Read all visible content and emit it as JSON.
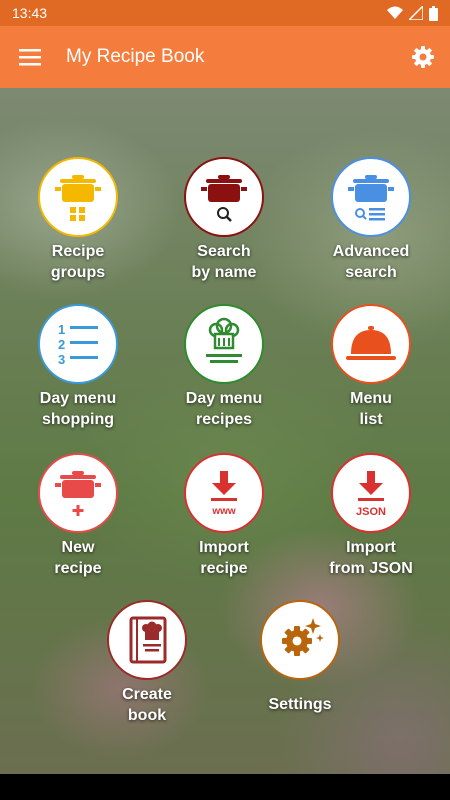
{
  "status_bar": {
    "time": "13:43"
  },
  "app_bar": {
    "title": "My Recipe Book"
  },
  "tiles": [
    {
      "label": "Recipe\ngroups",
      "icon": "pot-groups-icon",
      "color": "#f5b800"
    },
    {
      "label": "Search\nby name",
      "icon": "pot-search-icon",
      "color": "#8b1010"
    },
    {
      "label": "Advanced\nsearch",
      "icon": "pot-advanced-search-icon",
      "color": "#4a90e2"
    },
    {
      "label": "Day menu\nshopping",
      "icon": "numbered-list-icon",
      "color": "#3a9ad9"
    },
    {
      "label": "Day menu\nrecipes",
      "icon": "chef-hat-icon",
      "color": "#2e8b2e"
    },
    {
      "label": "Menu\nlist",
      "icon": "cloche-icon",
      "color": "#e8501e"
    },
    {
      "label": "New\nrecipe",
      "icon": "pot-add-icon",
      "color": "#e84a4a"
    },
    {
      "label": "Import\nrecipe",
      "icon": "download-www-icon",
      "color": "#d93030"
    },
    {
      "label": "Import\nfrom JSON",
      "icon": "download-json-icon",
      "color": "#d93030"
    },
    {
      "label": "Create\nbook",
      "icon": "cookbook-icon",
      "color": "#9b2a2a"
    },
    {
      "label": "Settings",
      "icon": "gears-icon",
      "color": "#b8650c"
    }
  ]
}
